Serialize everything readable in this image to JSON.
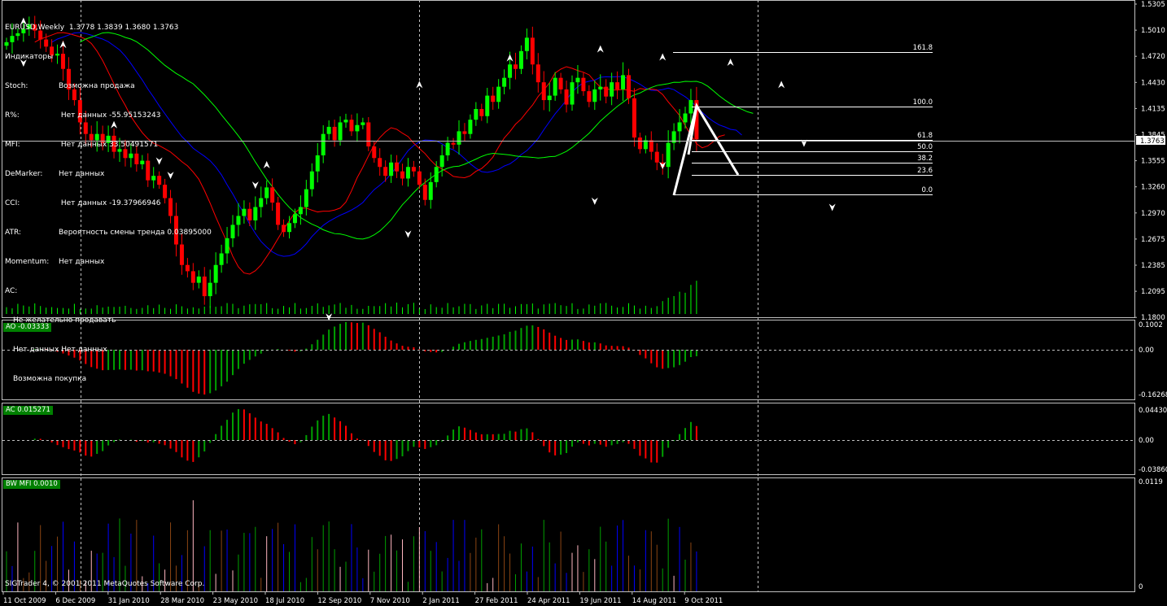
{
  "header": {
    "symbol_line": "EURUSD,Weekly  1.3778 1.3839 1.3680 1.3763",
    "indicators_title": "Индикаторы",
    "rows": [
      {
        "label": "Stoch:",
        "value": "Возможна продажа"
      },
      {
        "label": "R%:",
        "value": " Нет данных -55.95153243"
      },
      {
        "label": "MFI:",
        "value": " Нет данных 33.50491571"
      },
      {
        "label": "DeMarker:",
        "value": "Нет данных"
      },
      {
        "label": "CCI:",
        "value": " Нет данных -19.37966946"
      },
      {
        "label": "ATR:",
        "value": "Вероятность смены тренда 0.03895000"
      },
      {
        "label": "Momentum:",
        "value": "Нет данных"
      },
      {
        "label": "AC:",
        "value": ""
      }
    ],
    "ac_sublines": [
      "Не желательно продавать",
      "Нет данных Нет данных",
      "Возможна покупка"
    ]
  },
  "copyright": "SIGTrader 4, © 2001-2011 MetaQuotes Software Corp.",
  "colors": {
    "bull": "#00ff00",
    "bear": "#ff0000",
    "ma_red": "#ff0000",
    "ma_blue": "#0000ff",
    "ma_green": "#00ff00",
    "grid": "#c0c0c0",
    "fib": "#ffffff",
    "bw_green": "#00a000",
    "bw_blue": "#0000ff",
    "bw_pink": "#ffb6c1",
    "bw_brown": "#8b4513"
  },
  "price_axis": {
    "ticks": [
      "1.5305",
      "1.5010",
      "1.4720",
      "1.4430",
      "1.4135",
      "1.3845",
      "1.3555",
      "1.3260",
      "1.2970",
      "1.2675",
      "1.2385",
      "1.2095",
      "1.1800"
    ],
    "current_price": "1.3763"
  },
  "panes": {
    "ao": {
      "label": "AO -0.03333",
      "ticks": [
        "0.1002",
        "0.00",
        "-0.16268"
      ]
    },
    "ac": {
      "label": "AC 0.015271",
      "ticks": [
        "0.04430",
        "0.00",
        "-0.03860"
      ]
    },
    "bwmfi": {
      "label": "BW MFI 0.0010",
      "ticks": [
        "0.0119",
        "0"
      ]
    }
  },
  "fib_levels": [
    "161.8",
    "100.0",
    "61.8",
    "50.0",
    "38.2",
    "23.6",
    "0.0"
  ],
  "time_axis": [
    "11 Oct 2009",
    "6 Dec 2009",
    "31 Jan 2010",
    "28 Mar 2010",
    "23 May 2010",
    "18 Jul 2010",
    "12 Sep 2010",
    "7 Nov 2010",
    "2 Jan 2011",
    "27 Feb 2011",
    "24 Apr 2011",
    "19 Jun 2011",
    "14 Aug 2011",
    "9 Oct 2011"
  ],
  "chart_data": {
    "type": "candlestick",
    "symbol": "EURUSD",
    "timeframe": "Weekly",
    "ylim": [
      1.18,
      1.5305
    ],
    "closes": [
      1.485,
      1.492,
      1.495,
      1.5,
      1.505,
      1.498,
      1.488,
      1.48,
      1.47,
      1.472,
      1.455,
      1.432,
      1.42,
      1.395,
      1.382,
      1.375,
      1.382,
      1.372,
      1.38,
      1.362,
      1.365,
      1.355,
      1.36,
      1.348,
      1.352,
      1.33,
      1.335,
      1.325,
      1.31,
      1.29,
      1.258,
      1.235,
      1.228,
      1.215,
      1.222,
      1.2,
      1.215,
      1.235,
      1.248,
      1.265,
      1.28,
      1.29,
      1.298,
      1.285,
      1.3,
      1.31,
      1.322,
      1.305,
      1.28,
      1.272,
      1.282,
      1.292,
      1.3,
      1.32,
      1.34,
      1.358,
      1.382,
      1.39,
      1.375,
      1.395,
      1.398,
      1.385,
      1.392,
      1.395,
      1.368,
      1.355,
      1.345,
      1.335,
      1.35,
      1.34,
      1.332,
      1.345,
      1.34,
      1.325,
      1.308,
      1.328,
      1.345,
      1.358,
      1.372,
      1.37,
      1.385,
      1.382,
      1.398,
      1.41,
      1.402,
      1.425,
      1.418,
      1.435,
      1.445,
      1.46,
      1.455,
      1.475,
      1.49,
      1.46,
      1.44,
      1.42,
      1.425,
      1.445,
      1.432,
      1.415,
      1.44,
      1.445,
      1.43,
      1.418,
      1.432,
      1.435,
      1.424,
      1.44,
      1.432,
      1.448,
      1.422,
      1.378,
      1.365,
      1.375,
      1.362,
      1.35,
      1.345,
      1.372,
      1.385,
      1.395,
      1.405,
      1.42,
      1.376
    ],
    "bull_arrows": [
      [
        3,
        1.508
      ],
      [
        10,
        1.482
      ],
      [
        19,
        1.392
      ],
      [
        46,
        1.347
      ],
      [
        73,
        1.437
      ],
      [
        89,
        1.467
      ],
      [
        105,
        1.477
      ],
      [
        116,
        1.468
      ],
      [
        128,
        1.462
      ],
      [
        137,
        1.437
      ]
    ],
    "bear_arrows": [
      [
        3,
        1.462
      ],
      [
        27,
        1.352
      ],
      [
        29,
        1.336
      ],
      [
        44,
        1.325
      ],
      [
        57,
        1.177
      ],
      [
        71,
        1.27
      ],
      [
        104,
        1.307
      ],
      [
        116,
        1.347
      ],
      [
        141,
        1.372
      ],
      [
        146,
        1.3
      ]
    ]
  }
}
